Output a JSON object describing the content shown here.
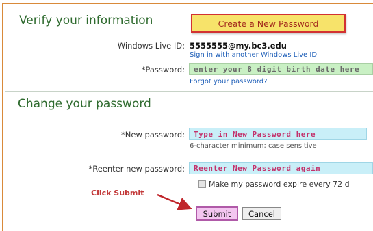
{
  "verify": {
    "title": "Verify your information",
    "callout": "Create a New Password",
    "live_id_label": "Windows Live ID:",
    "live_id_value": "5555555@my.bc3.edu",
    "sign_in_other": "Sign in with another Windows Live ID",
    "password_label": "*Password:",
    "password_value": "enter your 8 digit birth date here",
    "forgot": "Forgot your password?"
  },
  "change": {
    "title": "Change your password",
    "new_label": "*New password:",
    "new_value": "Type in New Password here",
    "new_hint": "6-character minimum; case sensitive",
    "reenter_label": "*Reenter new password:",
    "reenter_value": "Reenter New Password again",
    "expire_label": "Make my password expire every 72 d"
  },
  "annotation": {
    "click_submit": "Click Submit"
  },
  "buttons": {
    "submit": "Submit",
    "cancel": "Cancel"
  },
  "colors": {
    "section_title": "#2f6b2f",
    "callout_bg": "#f7e36a",
    "callout_border": "#d23232",
    "field_green": "#c9f0c4",
    "field_blue": "#c9eff8",
    "submit_bg": "#f3c6f0",
    "arrow": "#c0262b"
  }
}
